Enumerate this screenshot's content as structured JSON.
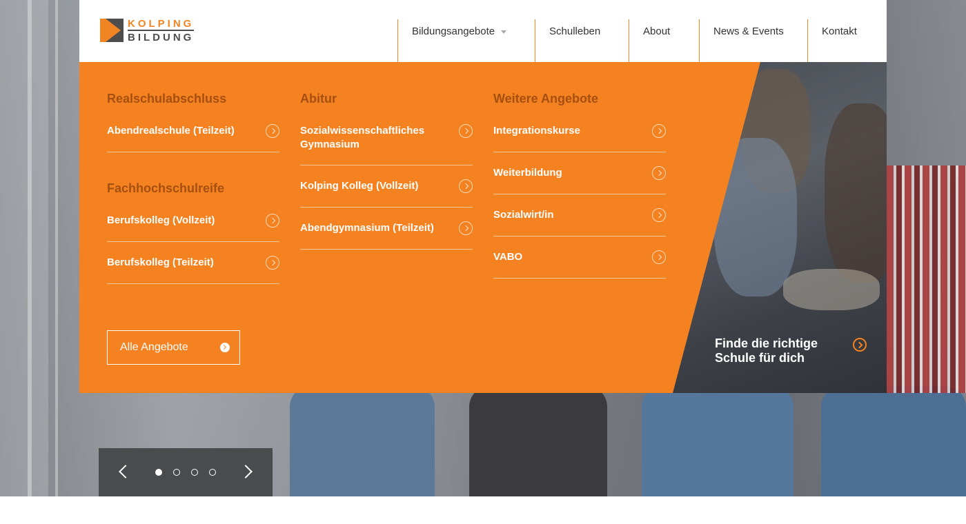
{
  "logo": {
    "top": "KOLPING",
    "bottom": "BILDUNG"
  },
  "nav": [
    {
      "label": "Bildungsangebote",
      "has_dropdown": true
    },
    {
      "label": "Schulleben"
    },
    {
      "label": "About"
    },
    {
      "label": "News & Events"
    },
    {
      "label": "Kontakt"
    }
  ],
  "mega_menu": {
    "columns": [
      {
        "groups": [
          {
            "title": "Realschulabschluss",
            "links": [
              "Abendrealschule (Teilzeit)"
            ]
          },
          {
            "title": "Fachhochschulreife",
            "links": [
              "Berufskolleg (Vollzeit)",
              "Berufskolleg (Teilzeit)"
            ]
          }
        ]
      },
      {
        "groups": [
          {
            "title": "Abitur",
            "links": [
              "Sozialwissenschaftliches Gymnasium",
              "Kolping Kolleg (Vollzeit)",
              "Abendgymnasium (Teilzeit)"
            ]
          }
        ]
      },
      {
        "groups": [
          {
            "title": "Weitere Angebote",
            "links": [
              "Integrationskurse",
              "Weiterbildung",
              "Sozialwirt/in",
              "VABO"
            ]
          }
        ]
      }
    ],
    "all_button": "Alle Angebote",
    "cta": "Finde die richtige Schule für dich"
  },
  "slider": {
    "slide_count": 4,
    "active_index": 0
  },
  "colors": {
    "accent": "#f58220",
    "heading_dark": "#a64f12",
    "slider_bg": "#4a4b4d"
  }
}
